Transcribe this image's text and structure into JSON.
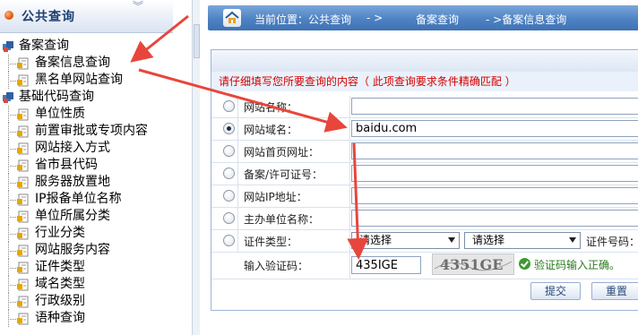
{
  "sidebar": {
    "title": "公共查询",
    "groups": [
      {
        "label": "备案查询",
        "items": [
          "备案信息查询",
          "黑名单网站查询"
        ]
      },
      {
        "label": "基础代码查询",
        "items": [
          "单位性质",
          "前置审批或专项内容",
          "网站接入方式",
          "省市县代码",
          "服务器放置地",
          "IP报备单位名称",
          "单位所属分类",
          "行业分类",
          "网站服务内容",
          "证件类型",
          "域名类型",
          "行政级别",
          "语种查询"
        ]
      }
    ]
  },
  "breadcrumb": {
    "prefix": "当前位置：公共查询",
    "sep1": "- >",
    "part2": "备案查询",
    "part3": "- >备案信息查询"
  },
  "form": {
    "notice": "请仔细填写您所要查询的内容（ 此项查询要求条件精确匹配 ）",
    "fields": [
      {
        "label": "网站名称：",
        "value": ""
      },
      {
        "label": "网站域名：",
        "value": "baidu.com"
      },
      {
        "label": "网站首页网址：",
        "value": ""
      },
      {
        "label": "备案/许可证号：",
        "value": ""
      },
      {
        "label": "网站IP地址：",
        "value": ""
      },
      {
        "label": "主办单位名称：",
        "value": ""
      }
    ],
    "cert_label": "证件类型：",
    "cert_select1": "请选择",
    "cert_select2": "请选择",
    "cert_no_label": "证件号码：",
    "captcha_label": "输入验证码：",
    "captcha_value": "435IGE",
    "captcha_image_text": "4351GE",
    "captcha_ok": "验证码输入正确。",
    "submit": "提交",
    "reset": "重置"
  },
  "colors": {
    "accent": "#4e82c3",
    "arrow": "#e8463c",
    "notice": "#d40000"
  },
  "icons": [
    "orange-dot-icon",
    "collapse-chevron-icon",
    "folder-icon",
    "document-icon",
    "home-icon",
    "check-icon"
  ]
}
